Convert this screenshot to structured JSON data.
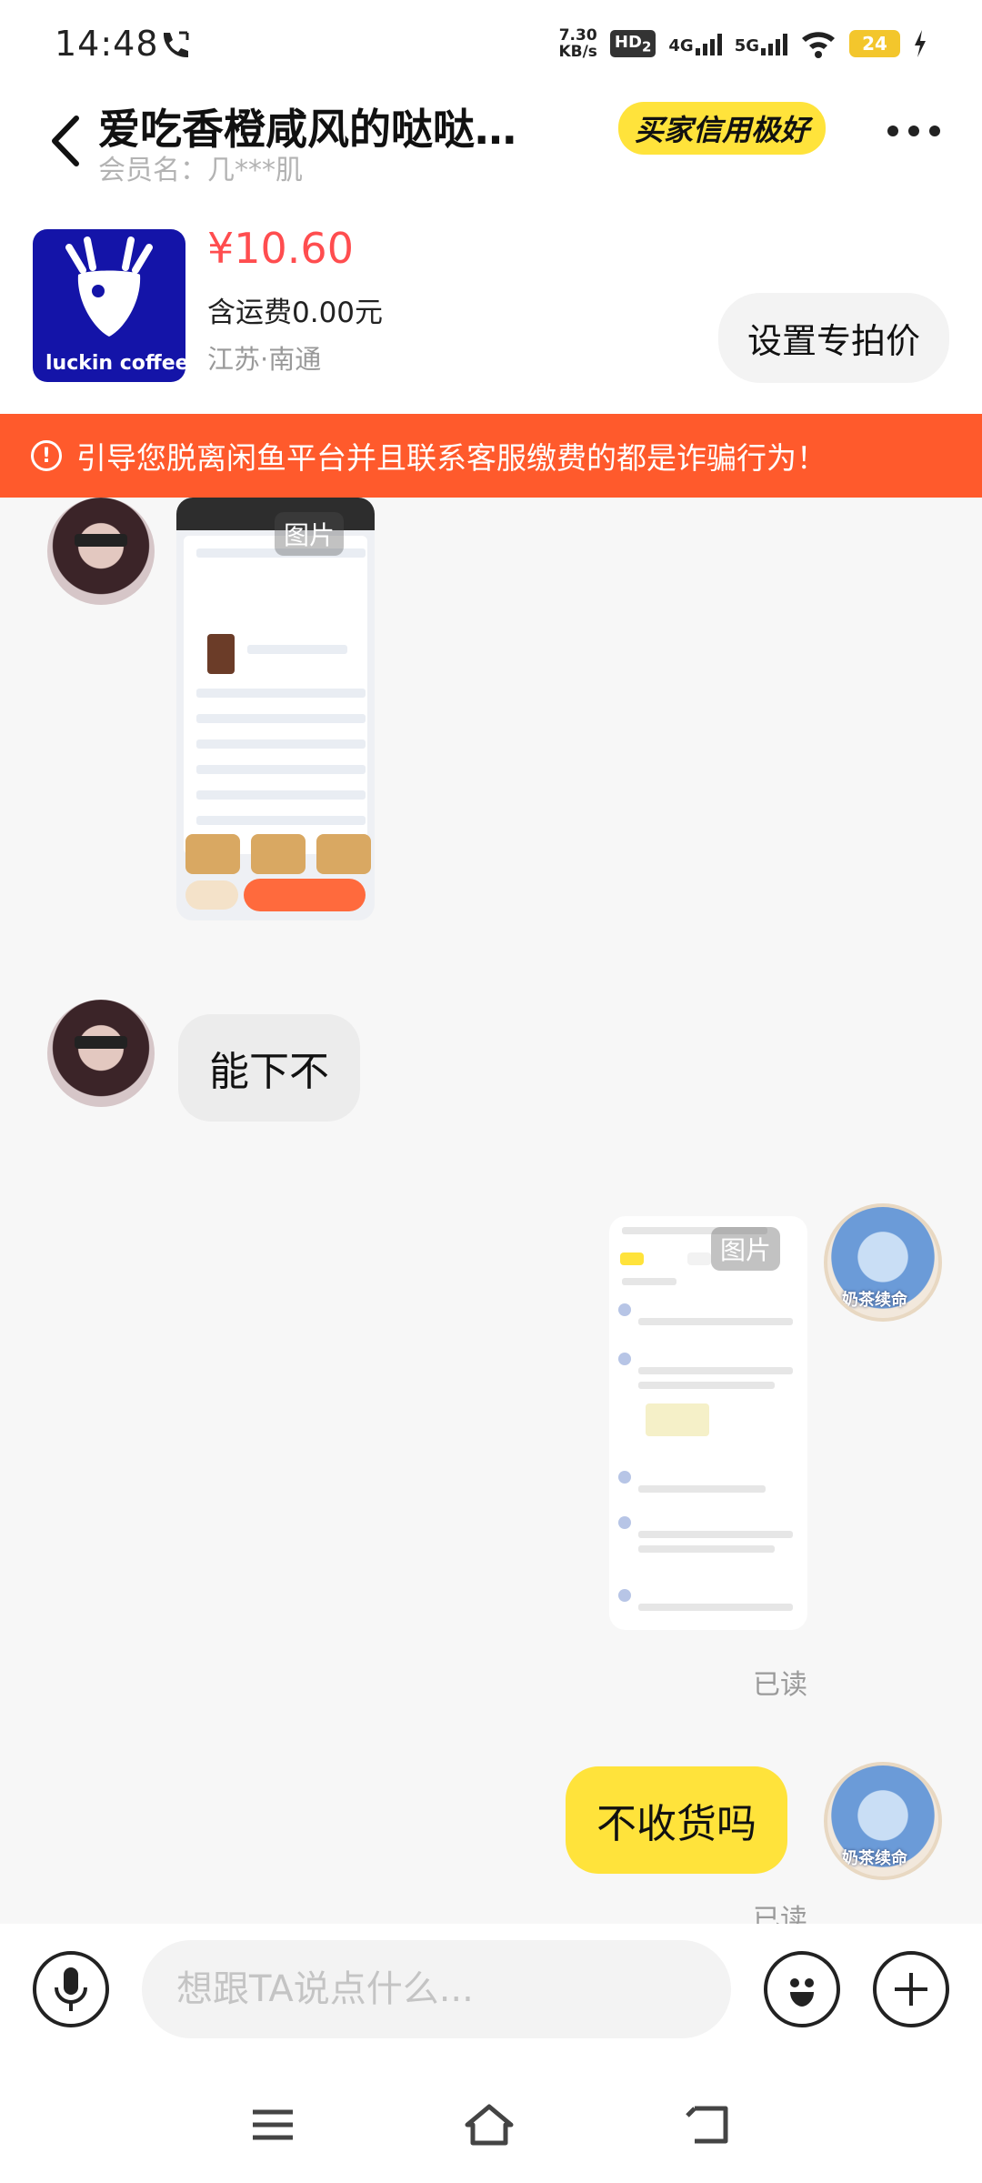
{
  "status_bar": {
    "time": "14:48",
    "net_speed_value": "7.30",
    "net_speed_unit": "KB/s",
    "hd_badge": "HD",
    "hd_sub": "2",
    "signal_1": "4G",
    "signal_2": "5G",
    "battery": "24"
  },
  "header": {
    "title": "爱吃香橙咸风的哒哒…",
    "member_label": "会员名：几***肌",
    "credit_badge": "买家信用极好"
  },
  "product": {
    "thumb_text": "luckin coffee",
    "price": "¥10.60",
    "shipping": "含运费0.00元",
    "location": "江苏·南通",
    "set_price_button": "设置专拍价"
  },
  "warning": {
    "icon": "!",
    "text": "引导您脱离闲鱼平台并且联系客服缴费的都是诈骗行为！"
  },
  "messages": {
    "image_label_1": "图片",
    "text_left": "能下不",
    "image_label_2": "图片",
    "read_1": "已读",
    "text_right": "不收货吗",
    "read_2": "已读",
    "avatar_tag": "奶茶续命"
  },
  "input": {
    "placeholder": "想跟TA说点什么..."
  },
  "colors": {
    "accent_yellow": "#ffe33b",
    "warning_orange": "#ff5a2c",
    "price_red": "#ff4d4f",
    "brand_blue": "#1414a8"
  }
}
